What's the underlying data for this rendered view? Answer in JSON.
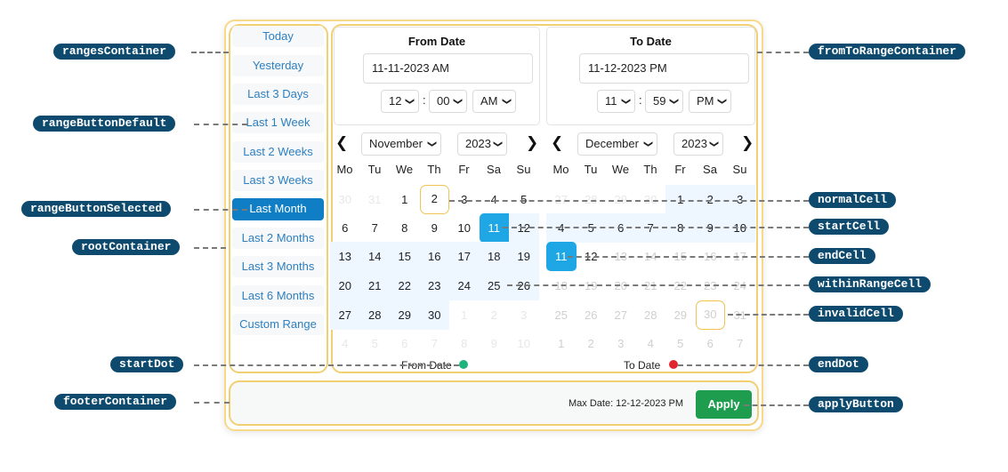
{
  "ranges": {
    "items": [
      {
        "label": "Today",
        "selected": false
      },
      {
        "label": "Yesterday",
        "selected": false
      },
      {
        "label": "Last 3 Days",
        "selected": false
      },
      {
        "label": "Last 1 Week",
        "selected": false
      },
      {
        "label": "Last 2 Weeks",
        "selected": false
      },
      {
        "label": "Last 3 Weeks",
        "selected": false
      },
      {
        "label": "Last Month",
        "selected": true
      },
      {
        "label": "Last 2 Months",
        "selected": false
      },
      {
        "label": "Last 3 Months",
        "selected": false
      },
      {
        "label": "Last 6 Months",
        "selected": false
      },
      {
        "label": "Custom Range",
        "selected": false
      }
    ]
  },
  "from": {
    "title": "From Date",
    "value": "11-11-2023 AM",
    "hour": "12",
    "minute": "00",
    "ampm": "AM",
    "month": "November",
    "year": "2023",
    "legend": "From Date",
    "dot_color": "#1fb47e"
  },
  "to": {
    "title": "To Date",
    "value": "11-12-2023 PM",
    "hour": "11",
    "minute": "59",
    "ampm": "PM",
    "month": "December",
    "year": "2023",
    "legend": "To Date",
    "dot_color": "#e0262f"
  },
  "time_separator": ":",
  "weekdays": [
    "Mo",
    "Tu",
    "We",
    "Th",
    "Fr",
    "Sa",
    "Su"
  ],
  "calendars": {
    "left": {
      "weeks": [
        [
          [
            "30",
            "out"
          ],
          [
            "31",
            "out"
          ],
          [
            "1",
            ""
          ],
          [
            "2",
            "outlined"
          ],
          [
            "3",
            ""
          ],
          [
            "4",
            ""
          ],
          [
            "5",
            ""
          ]
        ],
        [
          [
            "6",
            ""
          ],
          [
            "7",
            ""
          ],
          [
            "8",
            ""
          ],
          [
            "9",
            ""
          ],
          [
            "10",
            ""
          ],
          [
            "11",
            "start"
          ],
          [
            "12",
            "range"
          ]
        ],
        [
          [
            "13",
            "range"
          ],
          [
            "14",
            "range"
          ],
          [
            "15",
            "range"
          ],
          [
            "16",
            "range"
          ],
          [
            "17",
            "range"
          ],
          [
            "18",
            "range"
          ],
          [
            "19",
            "range"
          ]
        ],
        [
          [
            "20",
            "range"
          ],
          [
            "21",
            "range"
          ],
          [
            "22",
            "range"
          ],
          [
            "23",
            "range"
          ],
          [
            "24",
            "range"
          ],
          [
            "25",
            "range"
          ],
          [
            "26",
            "range"
          ]
        ],
        [
          [
            "27",
            "range"
          ],
          [
            "28",
            "range"
          ],
          [
            "29",
            "range"
          ],
          [
            "30",
            "range"
          ],
          [
            "1",
            "out"
          ],
          [
            "2",
            "out"
          ],
          [
            "3",
            "out"
          ]
        ],
        [
          [
            "4",
            "out"
          ],
          [
            "5",
            "out"
          ],
          [
            "6",
            "out"
          ],
          [
            "7",
            "out"
          ],
          [
            "8",
            "out"
          ],
          [
            "9",
            "out"
          ],
          [
            "10",
            "out"
          ]
        ]
      ]
    },
    "right": {
      "weeks": [
        [
          [
            "27",
            "out"
          ],
          [
            "28",
            "out"
          ],
          [
            "29",
            "out"
          ],
          [
            "30",
            "out"
          ],
          [
            "1",
            "range"
          ],
          [
            "2",
            "range"
          ],
          [
            "3",
            "range"
          ]
        ],
        [
          [
            "4",
            "range"
          ],
          [
            "5",
            "range"
          ],
          [
            "6",
            "range"
          ],
          [
            "7",
            "range"
          ],
          [
            "8",
            "range"
          ],
          [
            "9",
            "range"
          ],
          [
            "10",
            "range"
          ]
        ],
        [
          [
            "11",
            "end"
          ],
          [
            "12",
            ""
          ],
          [
            "13",
            "invalid"
          ],
          [
            "14",
            "invalid"
          ],
          [
            "15",
            "invalid"
          ],
          [
            "16",
            "invalid"
          ],
          [
            "17",
            "invalid"
          ]
        ],
        [
          [
            "18",
            "invalid"
          ],
          [
            "19",
            "invalid"
          ],
          [
            "20",
            "invalid"
          ],
          [
            "21",
            "invalid"
          ],
          [
            "22",
            "invalid"
          ],
          [
            "23",
            "invalid"
          ],
          [
            "24",
            "invalid"
          ]
        ],
        [
          [
            "25",
            "invalid"
          ],
          [
            "26",
            "invalid"
          ],
          [
            "27",
            "invalid"
          ],
          [
            "28",
            "invalid"
          ],
          [
            "29",
            "invalid"
          ],
          [
            "30",
            "invalid outlined"
          ],
          [
            "31",
            "invalid"
          ]
        ],
        [
          [
            "1",
            "invalid"
          ],
          [
            "2",
            "invalid"
          ],
          [
            "3",
            "invalid"
          ],
          [
            "4",
            "invalid"
          ],
          [
            "5",
            "invalid"
          ],
          [
            "6",
            "invalid"
          ],
          [
            "7",
            "invalid"
          ]
        ]
      ]
    }
  },
  "footer": {
    "max_date": "Max Date: 12-12-2023 PM",
    "apply_label": "Apply"
  },
  "icons": {
    "prev": "‹",
    "next": "›",
    "chevron_down": "⌄"
  },
  "annotations": {
    "rangesContainer": "rangesContainer",
    "rangeButtonDefault": "rangeButtonDefault",
    "rangeButtonSelected": "rangeButtonSelected",
    "rootContainer": "rootContainer",
    "startDot": "startDot",
    "footerContainer": "footerContainer",
    "fromToRangeContainer": "fromToRangeContainer",
    "normalCell": "normalCell",
    "startCell": "startCell",
    "endCell": "endCell",
    "withinRangeCell": "withinRangeCell",
    "invalidCell": "invalidCell",
    "endDot": "endDot",
    "applyButton": "applyButton"
  },
  "colors": {
    "accent_blue": "#1ea7e4",
    "selected_range_button": "#0f7ec5",
    "range_fill": "#eef7ff",
    "apply_green": "#1f9d4f",
    "highlight_border": "#f3cf74",
    "annotation_tag": "#0d4a6e"
  }
}
